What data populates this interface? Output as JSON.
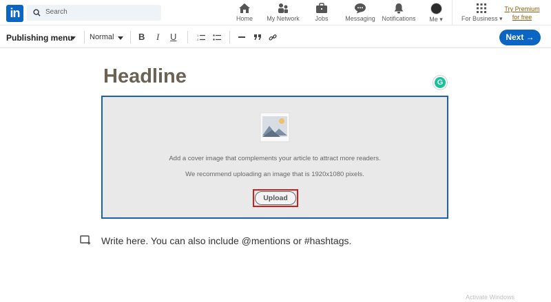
{
  "nav": {
    "logo": "in",
    "search_placeholder": "Search",
    "items": [
      {
        "label": "Home",
        "icon": "home-icon"
      },
      {
        "label": "My Network",
        "icon": "network-icon"
      },
      {
        "label": "Jobs",
        "icon": "briefcase-icon"
      },
      {
        "label": "Messaging",
        "icon": "chat-icon"
      },
      {
        "label": "Notifications",
        "icon": "bell-icon"
      },
      {
        "label": "Me",
        "icon": "avatar"
      },
      {
        "label": "For Business",
        "icon": "grid-icon"
      }
    ],
    "premium": "Try Premium for free"
  },
  "toolbar": {
    "publishing_menu": "Publishing menu",
    "style_select": "Normal",
    "bold": "B",
    "italic": "I",
    "underline": "U",
    "next_label": "Next"
  },
  "editor": {
    "headline_placeholder": "Headline",
    "grammarly_badge": "G",
    "cover_line1": "Add a cover image that complements your article to attract more readers.",
    "cover_line2": "We recommend uploading an image that is 1920x1080 pixels.",
    "upload_label": "Upload",
    "body_placeholder": "Write here. You can also include @mentions or #hashtags."
  },
  "watermark": "Activate Windows",
  "colors": {
    "brand": "#0a66c2",
    "cover_border": "#1a5fb4",
    "highlight": "#d01c1c",
    "headline": "#6b6255",
    "premium": "#915907"
  }
}
